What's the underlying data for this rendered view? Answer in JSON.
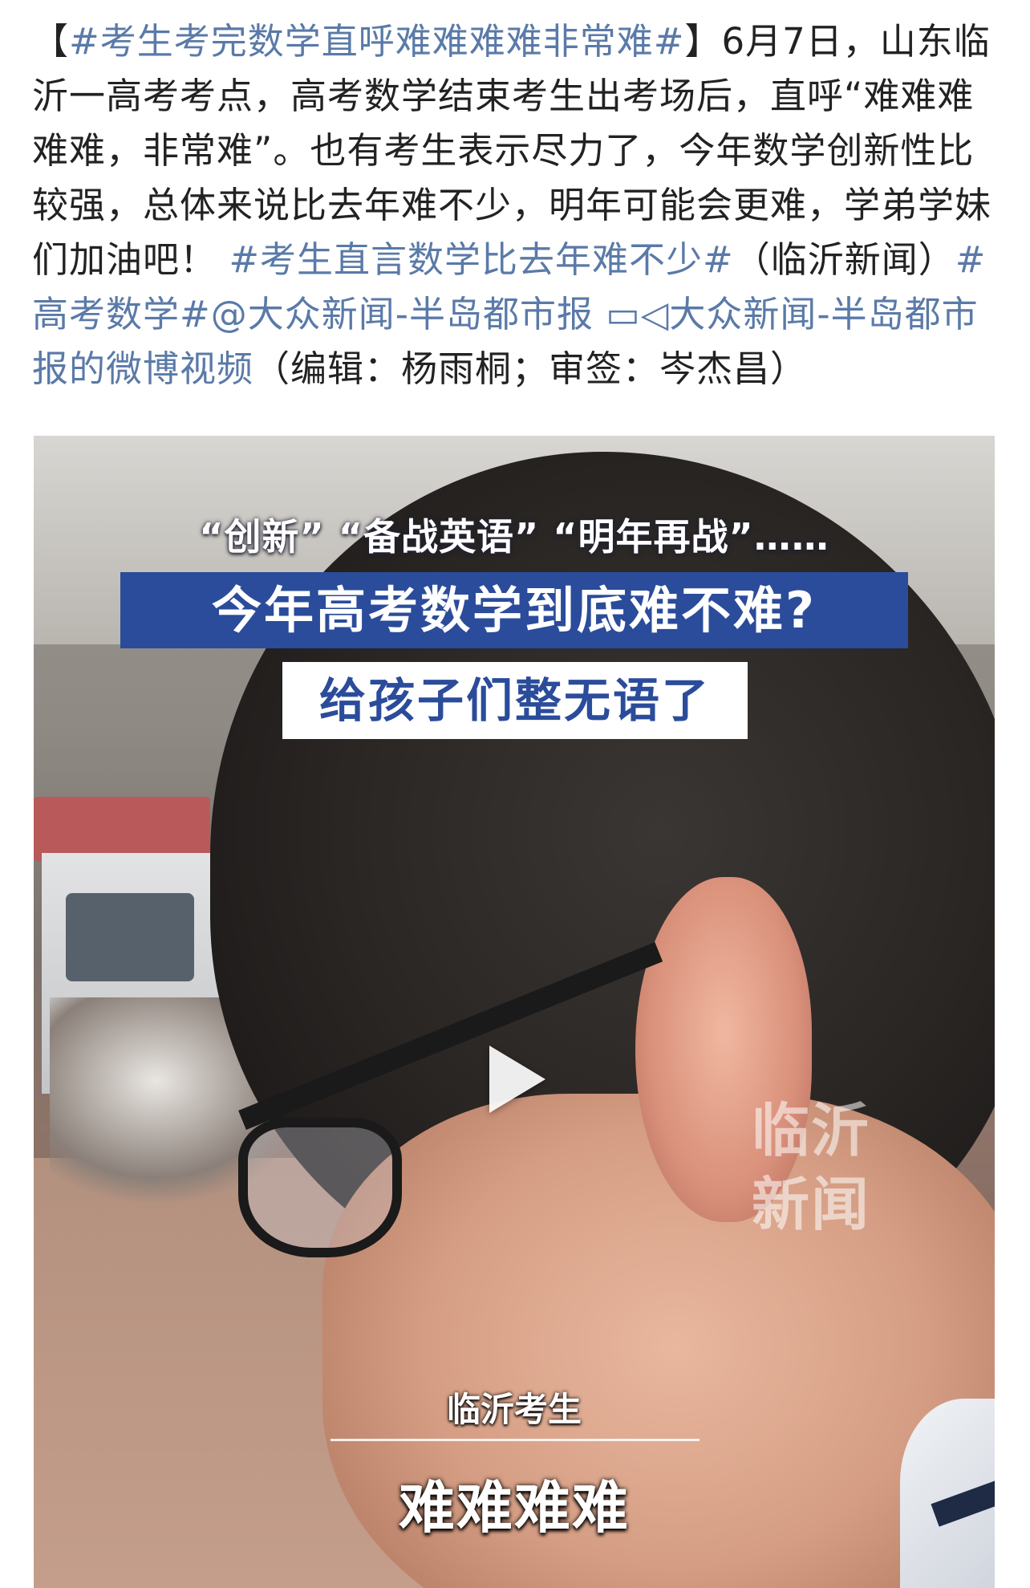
{
  "post": {
    "bracket_open": "【",
    "title_tag": "#考生考完数学直呼难难难难非常难#",
    "bracket_close": "】",
    "body": "6月7日，山东临沂一高考考点，高考数学结束考生出考场后，直呼“难难难难难，非常难”。也有考生表示尽力了，今年数学创新性比较强，总体来说比去年难不少，明年可能会更难，学弟学妹们加油吧！",
    "tag_2": "#考生直言数学比去年难不少#",
    "source_text": "（临沂新闻）",
    "tag_3": "#高考数学#",
    "mention": "@大众新闻-半岛都市报",
    "video_link_icon": "video-camera-icon",
    "video_link_glyph": "▭◁",
    "video_link": "大众新闻-半岛都市报的微博视频",
    "editor_note": "（编辑：杨雨桐；审签：岑杰昌）"
  },
  "video": {
    "quotes_line": "“创新” “备战英语” “明年再战”……",
    "headline": "今年高考数学到底难不难?",
    "sub_headline": "给孩子们整无语了",
    "watermark": "临沂新闻",
    "speaker_label": "临沂考生",
    "caption": "难难难难",
    "play_icon": "play-icon"
  },
  "colors": {
    "link": "#5a7aa8",
    "text": "#222222",
    "headline_bg": "#2b4c9b"
  }
}
